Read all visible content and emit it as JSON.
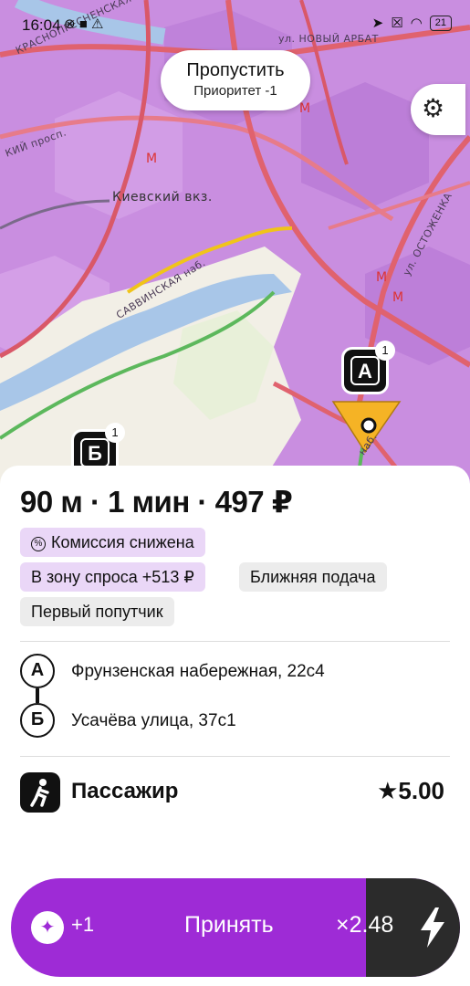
{
  "status_bar": {
    "time": "16:04",
    "battery": "21"
  },
  "map": {
    "street_labels": [
      "КРАСНОПРЕСНЕНСКАЯ наб.",
      "ул. НОВЫЙ АРБАТ",
      "КИЙ просп.",
      "Киевский вкз.",
      "САВВИНСКАЯ наб.",
      "ул. ОСТОЖЕНКА",
      "наб."
    ],
    "pin_a": {
      "letter": "А",
      "badge": "1"
    },
    "pin_b": {
      "letter": "Б",
      "badge": "1"
    },
    "skip": {
      "title": "Пропустить",
      "subtitle": "Приоритет -1"
    },
    "settings_icon": "gear-sun-icon"
  },
  "order": {
    "headline": "90 м · 1 мин · 497 ₽",
    "chips": {
      "commission": "Комиссия снижена",
      "demand_zone": "В зону спроса +513 ₽",
      "near_pickup": "Ближняя подача",
      "first_passenger": "Первый попутчик"
    },
    "route": {
      "from_letter": "А",
      "from_address": "Фрунзенская набережная, 22с4",
      "to_letter": "Б",
      "to_address": "Усачёва улица, 37с1"
    },
    "passenger": {
      "label": "Пассажир",
      "rating": "★5.00"
    }
  },
  "accept_bar": {
    "plus": "+1",
    "label": "Принять",
    "multiplier": "×2.48"
  },
  "colors": {
    "accent": "#9e2bd6",
    "map_demand": "#c98ee0",
    "chip_purple": "#ead7f7"
  }
}
